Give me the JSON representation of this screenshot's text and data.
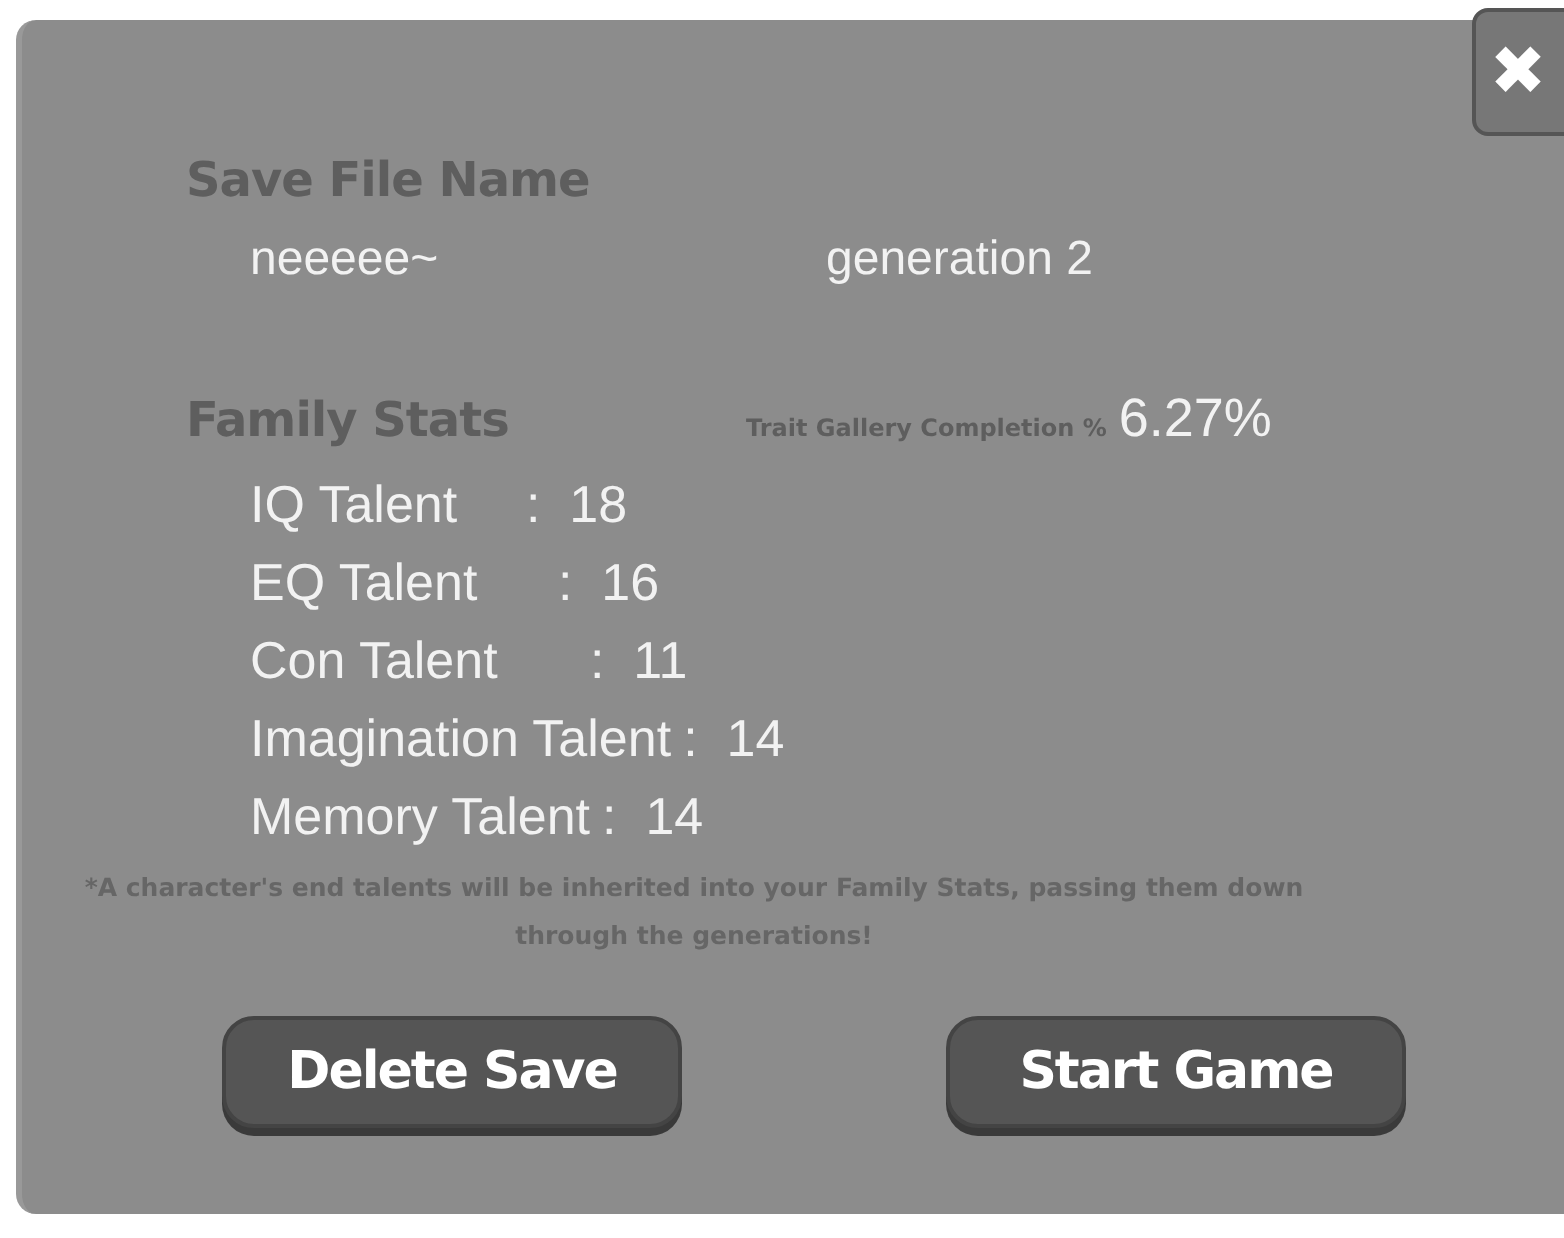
{
  "close_button": {
    "label": "✖"
  },
  "save_file": {
    "heading": "Save File Name",
    "name": "neeeee~",
    "generation": "generation 2"
  },
  "family_stats": {
    "heading": "Family Stats",
    "completion_label": "Trait Gallery Completion %",
    "completion_value": "6.27%",
    "stats": [
      {
        "label": "IQ Talent",
        "value": ":  18"
      },
      {
        "label": "EQ Talent",
        "value": ":  16"
      },
      {
        "label": "Con Talent",
        "value": ":  11"
      },
      {
        "label": "Imagination Talent",
        "value": ":  14"
      },
      {
        "label": "Memory Talent",
        "value": ":  14"
      }
    ]
  },
  "note": "*A character's end talents will be inherited into your Family Stats, passing them down through the generations!",
  "buttons": [
    "Delete Save",
    "Start Game"
  ]
}
